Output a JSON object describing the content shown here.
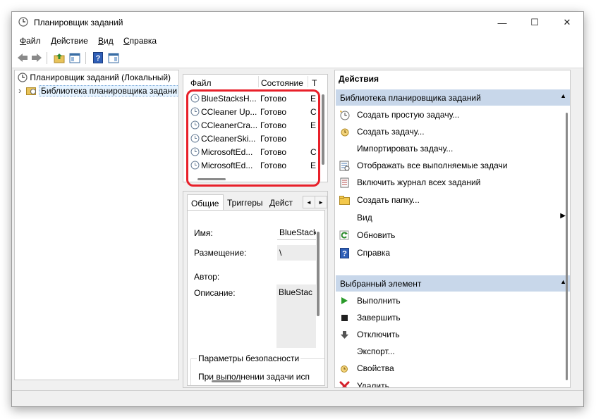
{
  "window": {
    "title": "Планировщик заданий",
    "controls": {
      "minimize": "—",
      "maximize": "☐",
      "close": "✕"
    }
  },
  "menu": [
    {
      "first": "Ф",
      "rest": "айл"
    },
    {
      "first": "Д",
      "rest": "ействие"
    },
    {
      "first": "В",
      "rest": "ид"
    },
    {
      "first": "С",
      "rest": "правка"
    }
  ],
  "toolbar": {
    "icons": [
      "back-icon",
      "forward-icon",
      "folder-up-icon",
      "show-hide-console-tree-icon",
      "help-icon",
      "show-hide-action-pane-icon"
    ]
  },
  "tree": {
    "root": "Планировщик заданий (Локальный)",
    "child": "Библиотека планировщика задани",
    "expander": "›"
  },
  "task_list": {
    "columns": [
      "Файл",
      "Состояние",
      "Т"
    ],
    "rows": [
      {
        "name": "BlueStacksH...",
        "status": "Готово",
        "trigger": "E"
      },
      {
        "name": "CCleaner Up...",
        "status": "Готово",
        "trigger": "C"
      },
      {
        "name": "CCleanerCra...",
        "status": "Готово",
        "trigger": "E"
      },
      {
        "name": "CCleanerSki...",
        "status": "Готово",
        "trigger": ""
      },
      {
        "name": "MicrosoftEd...",
        "status": "Готово",
        "trigger": "C"
      },
      {
        "name": "MicrosoftEd...",
        "status": "Готово",
        "trigger": "E"
      }
    ]
  },
  "details": {
    "tabs": [
      "Общие",
      "Триггеры",
      "Дейст"
    ],
    "arrows": [
      "◄",
      "►"
    ],
    "fields": {
      "name_label": "Имя:",
      "name_value": "BlueStack",
      "location_label": "Размещение:",
      "location_value": "\\",
      "author_label": "Автор:",
      "description_label": "Описание:",
      "description_value": "BlueStac"
    },
    "security_group": "Параметры безопасности",
    "security_text": "При выполнении задачи исп"
  },
  "actions": {
    "title": "Действия",
    "section1": {
      "title": "Библиотека планировщика заданий",
      "collapse": "▲",
      "items": [
        {
          "label": "Создать простую задачу...",
          "icon": "create-basic-task-icon"
        },
        {
          "label": "Создать задачу...",
          "icon": "create-task-icon"
        },
        {
          "label": "Импортировать задачу...",
          "icon": ""
        },
        {
          "label": "Отображать все выполняемые задачи",
          "icon": "running-tasks-icon"
        },
        {
          "label": "Включить журнал всех заданий",
          "icon": "history-log-icon"
        },
        {
          "label": "Создать папку...",
          "icon": "new-folder-icon"
        },
        {
          "label": "Вид",
          "icon": "",
          "arrow": "▶"
        },
        {
          "label": "Обновить",
          "icon": "refresh-icon"
        },
        {
          "label": "Справка",
          "icon": "help-icon"
        }
      ]
    },
    "section2": {
      "title": "Выбранный элемент",
      "collapse": "▲",
      "items": [
        {
          "label": "Выполнить",
          "icon": "run-icon"
        },
        {
          "label": "Завершить",
          "icon": "stop-icon"
        },
        {
          "label": "Отключить",
          "icon": "disable-icon"
        },
        {
          "label": "Экспорт...",
          "icon": ""
        },
        {
          "label": "Свойства",
          "icon": "properties-icon"
        },
        {
          "label": "Удалить",
          "icon": "delete-icon"
        }
      ]
    }
  },
  "colors": {
    "highlight": "#e8202a",
    "section_header": "#c8d7ea",
    "selection": "#e5f3ff"
  }
}
